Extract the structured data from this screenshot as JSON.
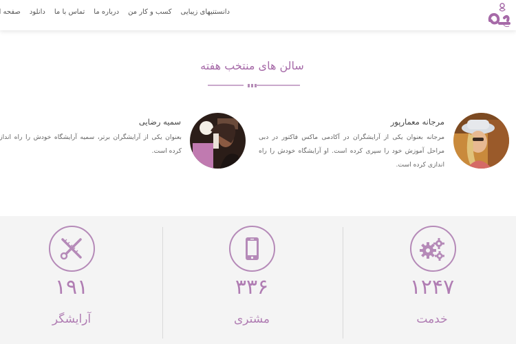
{
  "header": {
    "logo_icon": "salon-logo-icon",
    "nav": [
      "صفحه اصلی",
      "دانلود",
      "تماس با ما",
      "درباره ما",
      "کسب و کار من",
      "دانستنیهای زیبایی"
    ]
  },
  "featured": {
    "title": "سالن های منتخب هفته",
    "profiles": [
      {
        "name": "مرجانه معمارپور",
        "text": "مرجانه بعنوان یکی از آرایشگران در آکادمی ماکس فاکتور در دبی مراحل آموزش خود را سپری کرده است. او آرایشگاه خودش را راه اندازی کرده است."
      },
      {
        "name": "سمیه رضایی",
        "text": "بعنوان یکی از آرایشگران برتر، سمیه آرایشگاه خودش را راه اندازی کرده است."
      }
    ]
  },
  "stats": [
    {
      "icon": "gears-icon",
      "number": "۱۲۴۷",
      "label": "خدمت"
    },
    {
      "icon": "mobile-phone-icon",
      "number": "۳۳۶",
      "label": "مشتری"
    },
    {
      "icon": "scissors-comb-icon",
      "number": "۱۹۱",
      "label": "آرایشگر"
    }
  ],
  "colors": {
    "accent": "#a66aa8",
    "stats_background": "#f4f4f4"
  }
}
